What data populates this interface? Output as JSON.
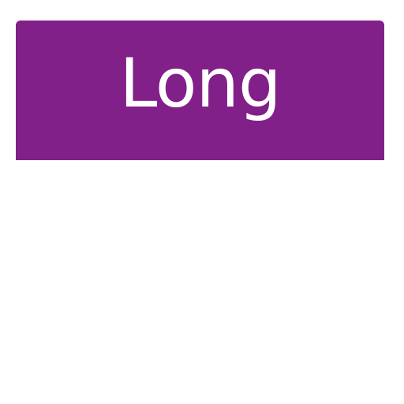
{
  "banner": {
    "label": "Long",
    "background_color": "#822089",
    "text_color": "#ffffff"
  }
}
